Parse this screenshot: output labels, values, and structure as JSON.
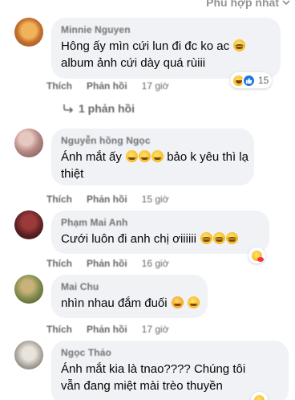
{
  "header": {
    "sort_label": "Phù hợp nhất"
  },
  "colors": {
    "bubble_bg": "#f0f2f5",
    "meta_text": "#65676b",
    "like_blue": "#1b74e4"
  },
  "comments": [
    {
      "author": "Minnie Nguyen",
      "lines": [
        "Hông ấy mìn cứi lun đi đc ko ac",
        "album ảnh cứi dày quá rùiii"
      ],
      "like_label": "Thích",
      "reply_label": "Phản hồi",
      "time": "17 giờ",
      "reaction_count": "15",
      "replies_label": "1 phản hồi"
    },
    {
      "author": "Nguyễn hồng Ngọc",
      "lines": [
        "Ánh mắt ấy",
        "bảo k yêu thì lạ",
        "thiệt"
      ],
      "like_label": "Thích",
      "reply_label": "Phản hồi",
      "time": "15 giờ"
    },
    {
      "author": "Phạm Mai Anh",
      "lines": [
        "Cưới luôn đi anh chị ơiiiiii"
      ],
      "like_label": "Thích",
      "reply_label": "Phản hồi",
      "time": "16 giờ"
    },
    {
      "author": "Mai Chu",
      "lines": [
        "nhìn nhau đắm đuối"
      ],
      "like_label": "Thích",
      "reply_label": "Phản hồi",
      "time": "17 giờ"
    },
    {
      "author": "Ngọc Thảo",
      "lines": [
        "Ánh mắt kia là tnao???? Chúng tôi",
        "vẫn đang miệt mài trèo thuyền"
      ]
    }
  ]
}
